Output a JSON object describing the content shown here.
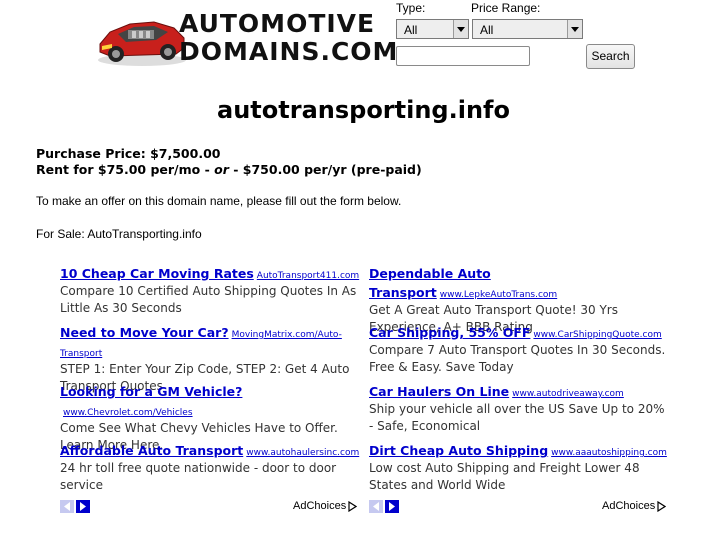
{
  "logo": {
    "line1": "AUTOMOTIVE",
    "line2": "DOMAINS.COM"
  },
  "search": {
    "type_label": "Type:",
    "type_value": "All",
    "price_label": "Price Range:",
    "price_value": "All",
    "text_value": "",
    "button_label": "Search"
  },
  "domain": "autotransporting.info",
  "pricing": {
    "purchase": "Purchase Price: $7,500.00",
    "rent_a": "Rent for $75.00 per/mo - ",
    "rent_or": "or",
    "rent_b": " - $750.00 per/yr (pre-paid)"
  },
  "offer_text": "To make an offer on this domain name, please fill out the form below.",
  "for_sale": "For Sale: AutoTransporting.info",
  "ads_left": [
    {
      "title": "10 Cheap Car Moving Rates",
      "url": "AutoTransport411.com",
      "desc": "Compare 10 Certified Auto Shipping Quotes In As Little As 30 Seconds"
    },
    {
      "title": "Need to Move Your Car?",
      "url": "MovingMatrix.com/Auto-Transport",
      "desc": "STEP 1: Enter Your Zip Code, STEP 2: Get 4 Auto Transport Quotes"
    },
    {
      "title": "Looking for a GM Vehicle?",
      "url": "www.Chevrolet.com/Vehicles",
      "desc": "Come See What Chevy Vehicles Have to Offer. Learn More Here."
    },
    {
      "title": "Affordable Auto Transport",
      "url": "www.autohaulersinc.com",
      "desc": "24 hr toll free quote nationwide - door to door service"
    }
  ],
  "ads_right": [
    {
      "title": "Dependable Auto Transport",
      "url": "www.LepkeAutoTrans.com",
      "desc": "Get A Great Auto Transport Quote! 30 Yrs Experience, A+ BBB Rating"
    },
    {
      "title": "Car Shipping, 55% OFF",
      "url": "www.CarShippingQuote.com",
      "desc": "Compare 7 Auto Transport Quotes In 30 Seconds. Free & Easy. Save Today"
    },
    {
      "title": "Car Haulers On Line",
      "url": "www.autodriveaway.com",
      "desc": "Ship your vehicle all over the US Save Up to 20% - Safe, Economical"
    },
    {
      "title": "Dirt Cheap Auto Shipping",
      "url": "www.aaautoshipping.com",
      "desc": "Low cost Auto Shipping and Freight Lower 48 States and World Wide"
    }
  ],
  "adchoices_label": "AdChoices",
  "colors": {
    "link": "#0000cc",
    "nav_prev": "#c6c9f0",
    "car_red": "#c8201c"
  }
}
